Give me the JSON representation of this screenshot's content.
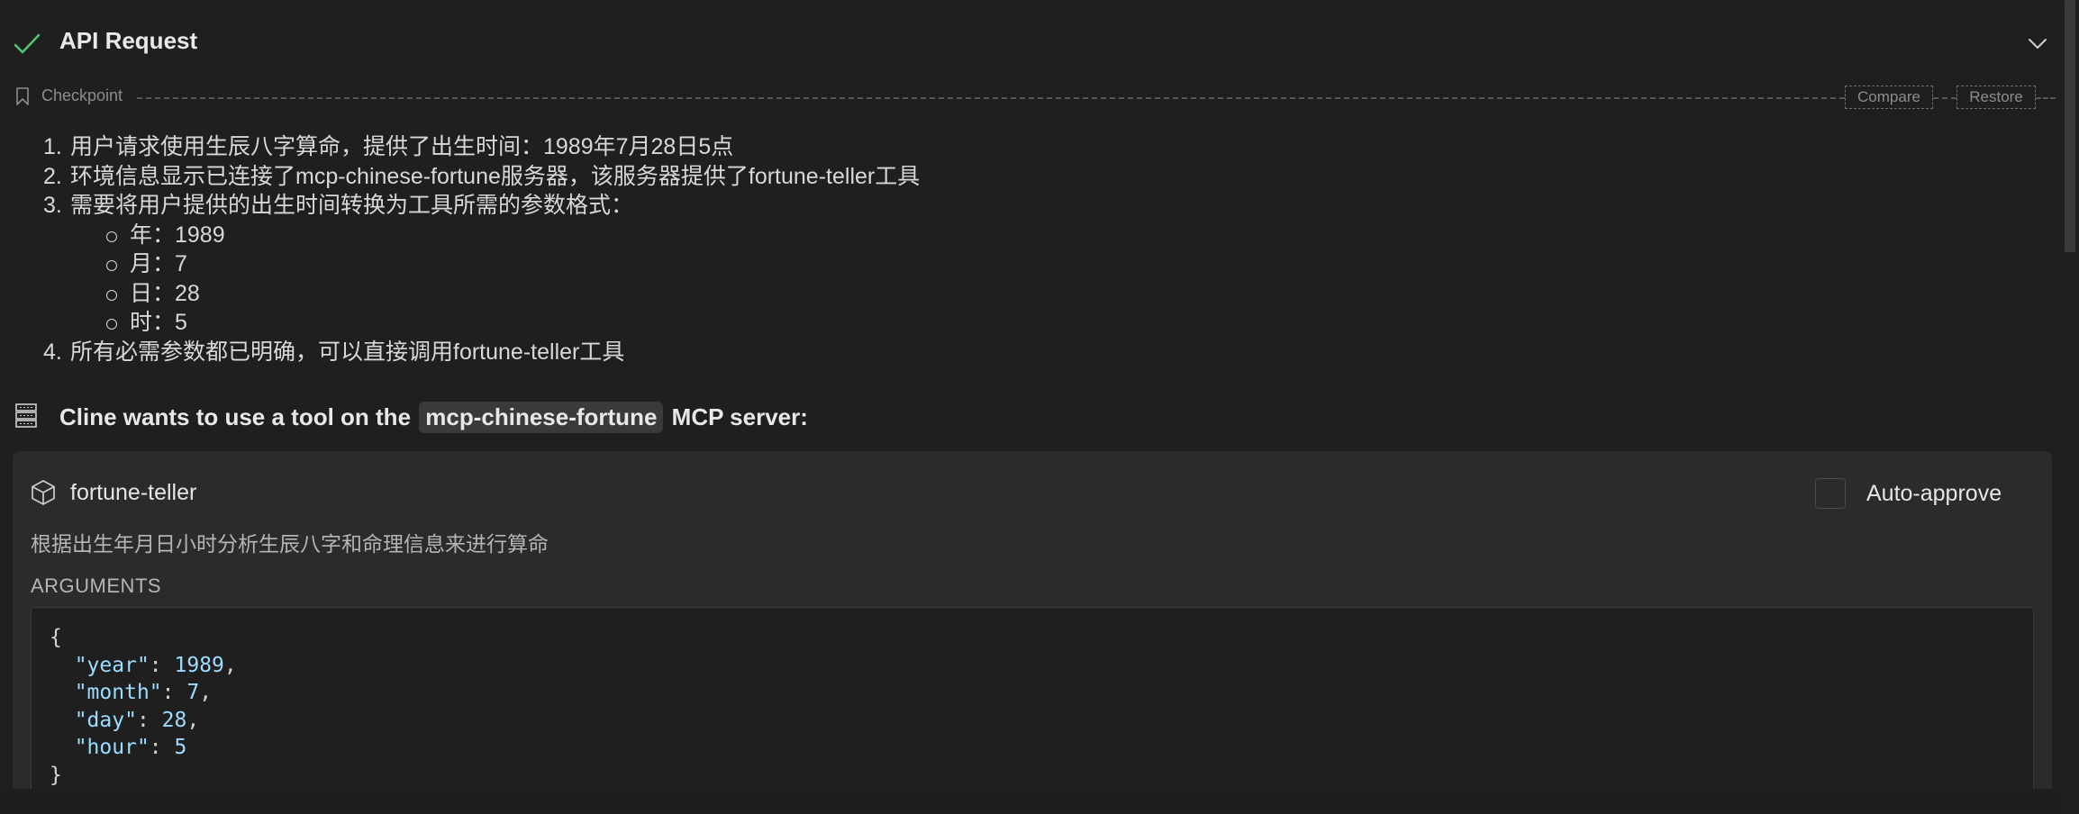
{
  "api_request": {
    "title": "API Request",
    "status_icon": "check-icon",
    "status_color": "#4ec96f",
    "toggle_icon": "chevron-down-icon"
  },
  "checkpoint": {
    "label": "Checkpoint",
    "compare_label": "Compare",
    "restore_label": "Restore"
  },
  "reasoning": {
    "items": [
      {
        "num": "1.",
        "text": "用户请求使用生辰八字算命，提供了出生时间：1989年7月28日5点"
      },
      {
        "num": "2.",
        "text": "环境信息显示已连接了mcp-chinese-fortune服务器，该服务器提供了fortune-teller工具"
      },
      {
        "num": "3.",
        "text": "需要将用户提供的出生时间转换为工具所需的参数格式："
      },
      {
        "num": "4.",
        "text": "所有必需参数都已明确，可以直接调用fortune-teller工具"
      }
    ],
    "sub_items": [
      "年：1989",
      "月：7",
      "日：28",
      "时：5"
    ]
  },
  "mcp": {
    "prefix": "Cline wants to use a tool on the",
    "server": "mcp-chinese-fortune",
    "suffix": "MCP server:"
  },
  "tool": {
    "name": "fortune-teller",
    "auto_approve_label": "Auto-approve",
    "auto_approve_checked": false,
    "description": "根据出生年月日小时分析生辰八字和命理信息来进行算命",
    "arguments_label": "ARGUMENTS",
    "arguments": {
      "open": "{",
      "year_key": "\"year\"",
      "year_val": "1989",
      "month_key": "\"month\"",
      "month_val": "7",
      "day_key": "\"day\"",
      "day_val": "28",
      "hour_key": "\"hour\"",
      "hour_val": "5",
      "close": "}"
    }
  }
}
